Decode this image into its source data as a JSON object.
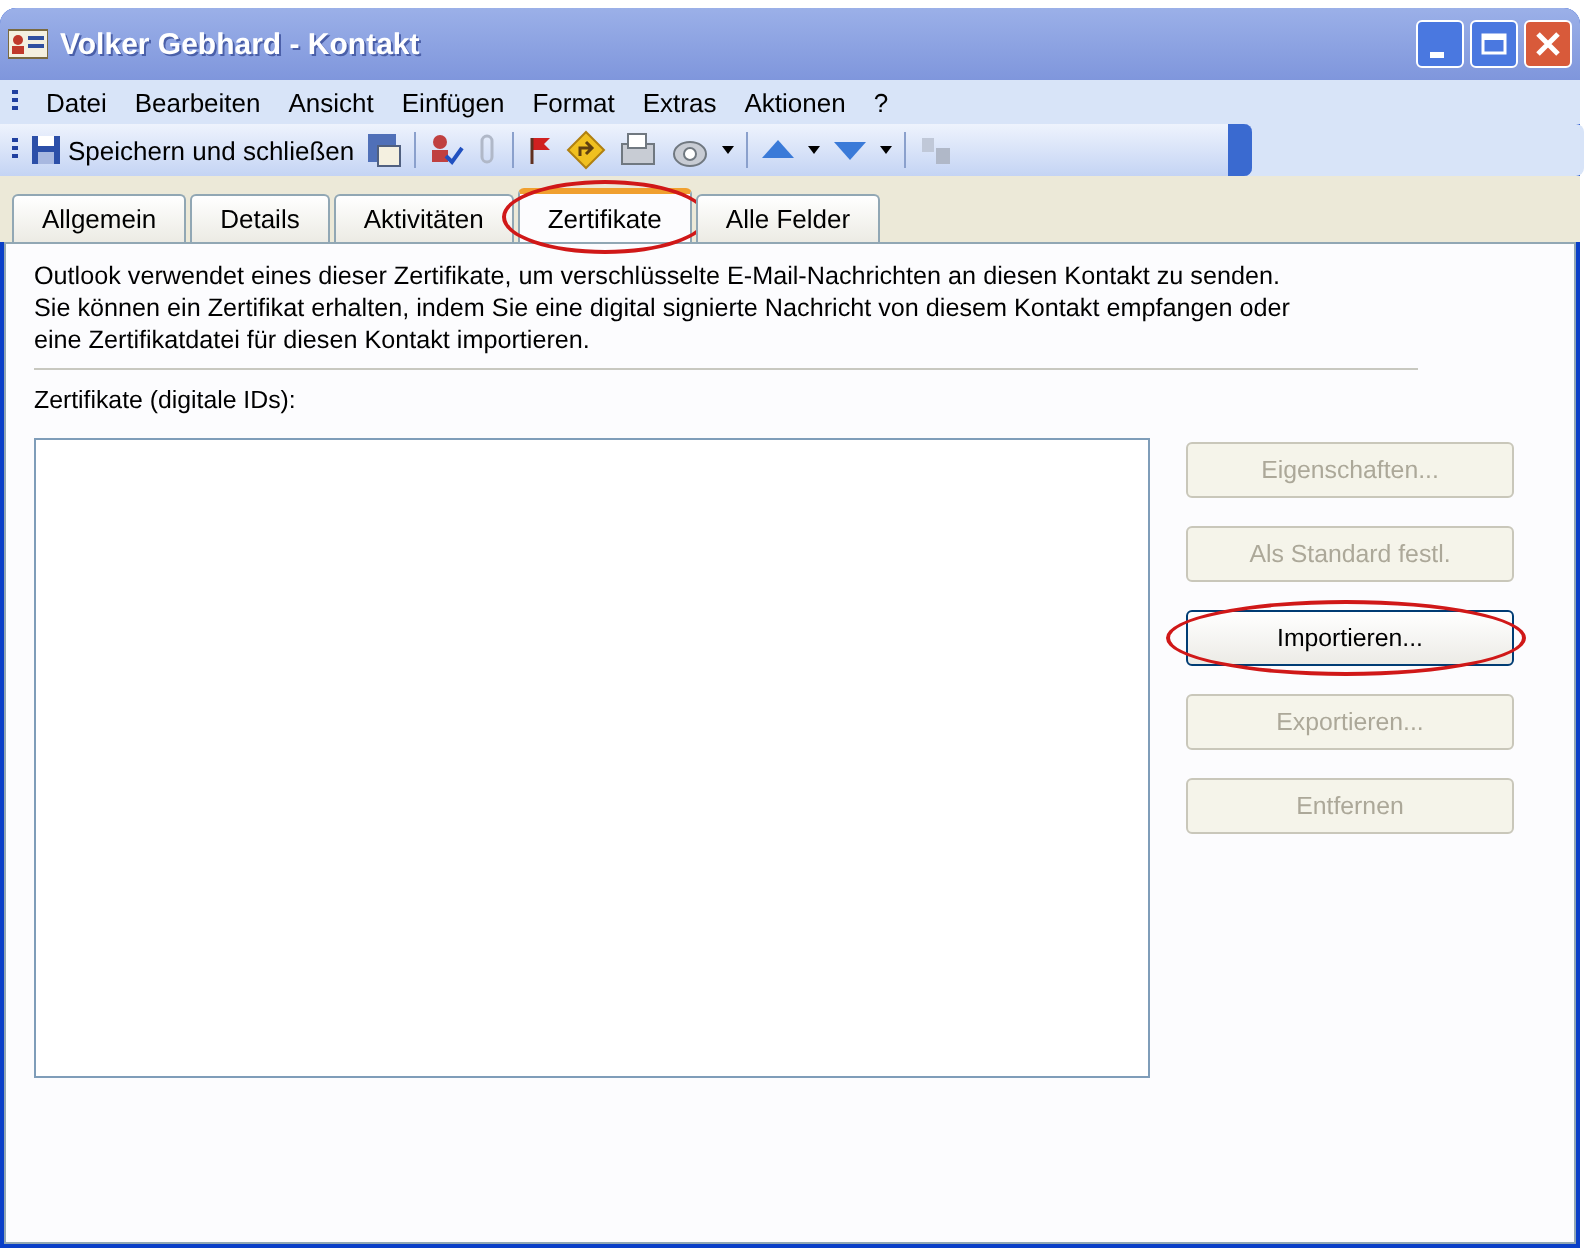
{
  "window": {
    "title": "Volker Gebhard - Kontakt"
  },
  "menu": [
    "Datei",
    "Bearbeiten",
    "Ansicht",
    "Einfügen",
    "Format",
    "Extras",
    "Aktionen",
    "?"
  ],
  "toolbar": {
    "save_label": "Speichern und schließen"
  },
  "tabs": [
    {
      "label": "Allgemein",
      "selected": false,
      "highlighted": false
    },
    {
      "label": "Details",
      "selected": false,
      "highlighted": false
    },
    {
      "label": "Aktivitäten",
      "selected": false,
      "highlighted": false
    },
    {
      "label": "Zertifikate",
      "selected": true,
      "highlighted": true
    },
    {
      "label": "Alle Felder",
      "selected": false,
      "highlighted": false
    }
  ],
  "description": "Outlook verwendet eines dieser Zertifikate, um verschlüsselte E-Mail-Nachrichten an diesen Kontakt zu senden. Sie können ein Zertifikat erhalten, indem Sie eine digital signierte Nachricht von diesem Kontakt empfangen oder eine Zertifikatdatei für diesen Kontakt importieren.",
  "list_label": "Zertifikate (digitale IDs):",
  "buttons": [
    {
      "label": "Eigenschaften...",
      "disabled": true,
      "highlighted": false
    },
    {
      "label": "Als Standard festl.",
      "disabled": true,
      "highlighted": false
    },
    {
      "label": "Importieren...",
      "disabled": false,
      "highlighted": true
    },
    {
      "label": "Exportieren...",
      "disabled": true,
      "highlighted": false
    },
    {
      "label": "Entfernen",
      "disabled": true,
      "highlighted": false
    }
  ]
}
